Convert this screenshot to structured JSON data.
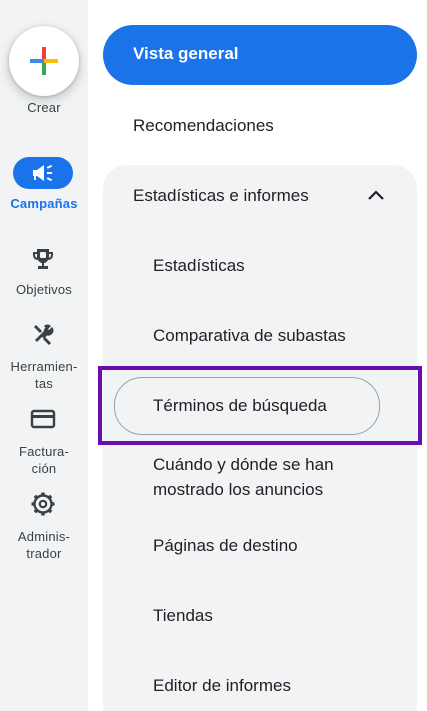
{
  "rail": {
    "create_label": "Crear",
    "campaigns_label": "Campañas",
    "goals_label": "Objetivos",
    "tools_label_1": "Herramien-",
    "tools_label_2": "tas",
    "billing_label_1": "Factura-",
    "billing_label_2": "ción",
    "admin_label_1": "Adminis-",
    "admin_label_2": "trador"
  },
  "nav": {
    "overview": "Vista general",
    "recommendations": "Recomendaciones",
    "insights_reports": "Estadísticas e informes",
    "sub": {
      "insights": "Estadísticas",
      "auction": "Comparativa de subastas",
      "search_terms": "Términos de búsqueda",
      "when_where_1": "Cuándo y dónde se han",
      "when_where_2": "mostrado los anuncios",
      "landing_pages": "Páginas de destino",
      "stores": "Tiendas",
      "report_editor": "Editor de informes"
    }
  },
  "colors": {
    "accent": "#1a73e8",
    "highlight": "#6a0dad",
    "rail_bg": "#f1f3f4"
  }
}
